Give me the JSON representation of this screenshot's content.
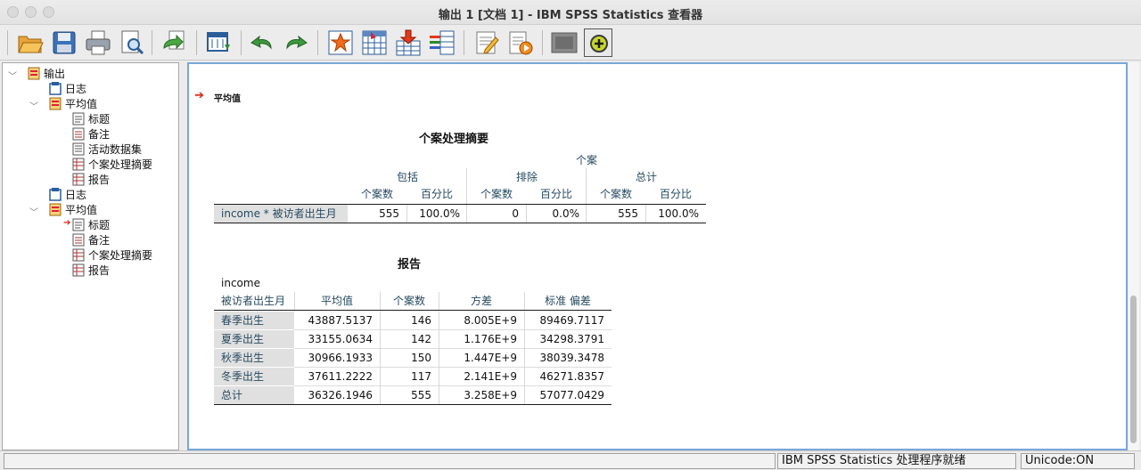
{
  "window": {
    "title": "输出 1 [文档 1] - IBM SPSS Statistics 查看器"
  },
  "toolbar": {
    "icons": [
      "open-icon",
      "save-icon",
      "print-icon",
      "print-preview-icon",
      "export-icon",
      "goto-data-icon",
      "undo-icon",
      "redo-icon",
      "goto-case-icon",
      "goto-variable-icon",
      "insert-variable-icon",
      "split-file-icon",
      "select-cases-icon",
      "value-labels-icon",
      "designate-window-icon",
      "add-icon"
    ]
  },
  "tree": {
    "nodes": [
      {
        "label": "输出",
        "icon": "output-book-icon"
      },
      {
        "label": "日志",
        "icon": "log-icon"
      },
      {
        "label": "平均值",
        "icon": "procedure-book-icon"
      },
      {
        "label": "标题",
        "icon": "title-icon"
      },
      {
        "label": "备注",
        "icon": "notes-icon"
      },
      {
        "label": "活动数据集",
        "icon": "dataset-icon"
      },
      {
        "label": "个案处理摘要",
        "icon": "table-icon"
      },
      {
        "label": "报告",
        "icon": "table-icon"
      },
      {
        "label": "日志",
        "icon": "log-icon"
      },
      {
        "label": "平均值",
        "icon": "procedure-book-icon"
      },
      {
        "label": "标题",
        "icon": "title-icon"
      },
      {
        "label": "备注",
        "icon": "notes-icon"
      },
      {
        "label": "个案处理摘要",
        "icon": "table-icon"
      },
      {
        "label": "报告",
        "icon": "table-icon"
      }
    ]
  },
  "output": {
    "section_title": "平均值",
    "summary": {
      "title": "个案处理摘要",
      "top_header": "个案",
      "groups": [
        "包括",
        "排除",
        "总计"
      ],
      "subheaders": [
        "个案数",
        "百分比",
        "个案数",
        "百分比",
        "个案数",
        "百分比"
      ],
      "row_label": "income  * 被访者出生月",
      "row_values": [
        "555",
        "100.0%",
        "0",
        "0.0%",
        "555",
        "100.0%"
      ]
    },
    "report": {
      "title": "报告",
      "dependent": "income",
      "headers": [
        "被访者出生月",
        "平均值",
        "个案数",
        "方差",
        "标准 偏差"
      ],
      "rows": [
        [
          "春季出生",
          "43887.5137",
          "146",
          "8.005E+9",
          "89469.7117"
        ],
        [
          "夏季出生",
          "33155.0634",
          "142",
          "1.176E+9",
          "34298.3791"
        ],
        [
          "秋季出生",
          "30966.1933",
          "150",
          "1.447E+9",
          "38039.3478"
        ],
        [
          "冬季出生",
          "37611.2222",
          "117",
          "2.141E+9",
          "46271.8357"
        ],
        [
          "总计",
          "36326.1946",
          "555",
          "3.258E+9",
          "57077.0429"
        ]
      ]
    }
  },
  "status": {
    "message": "IBM SPSS Statistics 处理程序就绪",
    "unicode": "Unicode:ON"
  }
}
